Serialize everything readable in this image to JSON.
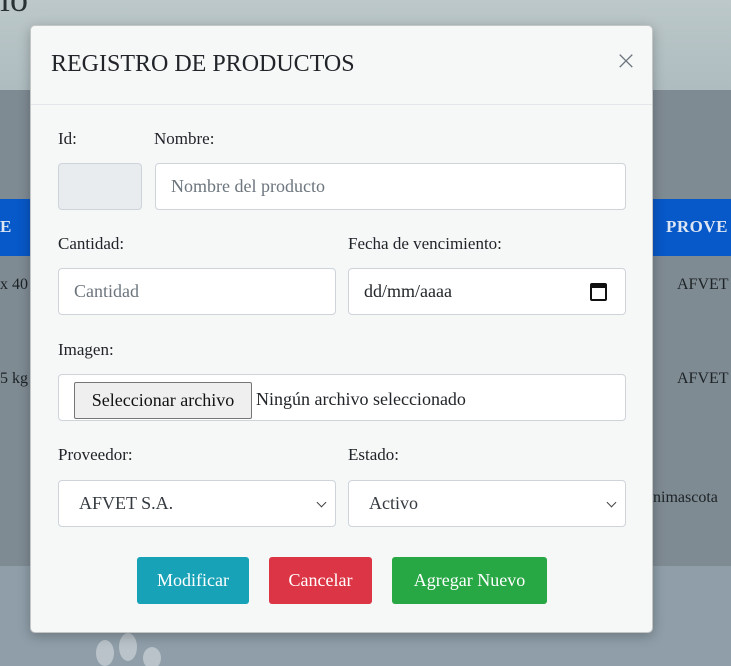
{
  "background": {
    "heading_fragment": "io",
    "table_header_left": "E",
    "table_header_right": "PROVE",
    "rows": [
      {
        "left": "x 40",
        "right": "AFVET"
      },
      {
        "left": "5 kg",
        "right": "AFVET"
      },
      {
        "left": "",
        "right": "nimascota"
      }
    ]
  },
  "modal": {
    "title": "REGISTRO DE PRODUCTOS",
    "close_symbol": "×",
    "id_label": "Id:",
    "id_value": "",
    "nombre_label": "Nombre:",
    "nombre_placeholder": "Nombre del producto",
    "cantidad_label": "Cantidad:",
    "cantidad_placeholder": "Cantidad",
    "fecha_label": "Fecha de vencimiento:",
    "fecha_placeholder": "dd/mm/aaaa",
    "imagen_label": "Imagen:",
    "file_button": "Seleccionar archivo",
    "file_status": "Ningún archivo seleccionado",
    "proveedor_label": "Proveedor:",
    "proveedor_value": "AFVET S.A.",
    "estado_label": "Estado:",
    "estado_value": "Activo",
    "buttons": {
      "modificar": "Modificar",
      "cancelar": "Cancelar",
      "agregar": "Agregar Nuevo"
    }
  },
  "colors": {
    "info": "#17a2b8",
    "danger": "#dc3545",
    "success": "#28a745",
    "table_header": "#0758c8"
  },
  "icons": [
    "close-icon",
    "calendar-icon",
    "chevron-down-icon",
    "paw-icon"
  ]
}
